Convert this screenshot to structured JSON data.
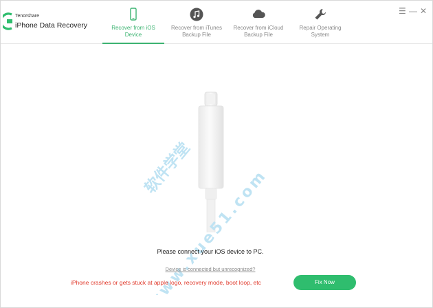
{
  "app": {
    "company": "Tenorshare",
    "product": "iPhone Data Recovery"
  },
  "tabs": [
    {
      "line1": "Recover from iOS",
      "line2": "Device",
      "icon": "iphone-icon",
      "active": true
    },
    {
      "line1": "Recover from iTunes",
      "line2": "Backup File",
      "icon": "music-note-icon",
      "active": false
    },
    {
      "line1": "Recover from iCloud",
      "line2": "Backup File",
      "icon": "cloud-icon",
      "active": false
    },
    {
      "line1": "Repair Operating",
      "line2": "System",
      "icon": "wrench-icon",
      "active": false
    }
  ],
  "window_controls": {
    "menu": "☰",
    "minimize": "—",
    "close": "✕"
  },
  "main": {
    "connect_message": "Please connect your iOS device to PC.",
    "unrecognized_link": "Device is connected but unrecognized?"
  },
  "footer": {
    "crash_message": "iPhone crashes or gets stuck at apple logo, recovery mode, boot loop, etc",
    "fix_button": "Fix Now"
  },
  "watermark": {
    "line1": "软件学堂",
    "line2": "www.xue51.com"
  },
  "colors": {
    "accent": "#3cb371",
    "button": "#2fbd6e",
    "warning": "#e0392b",
    "watermark": "#bfe3f3"
  }
}
